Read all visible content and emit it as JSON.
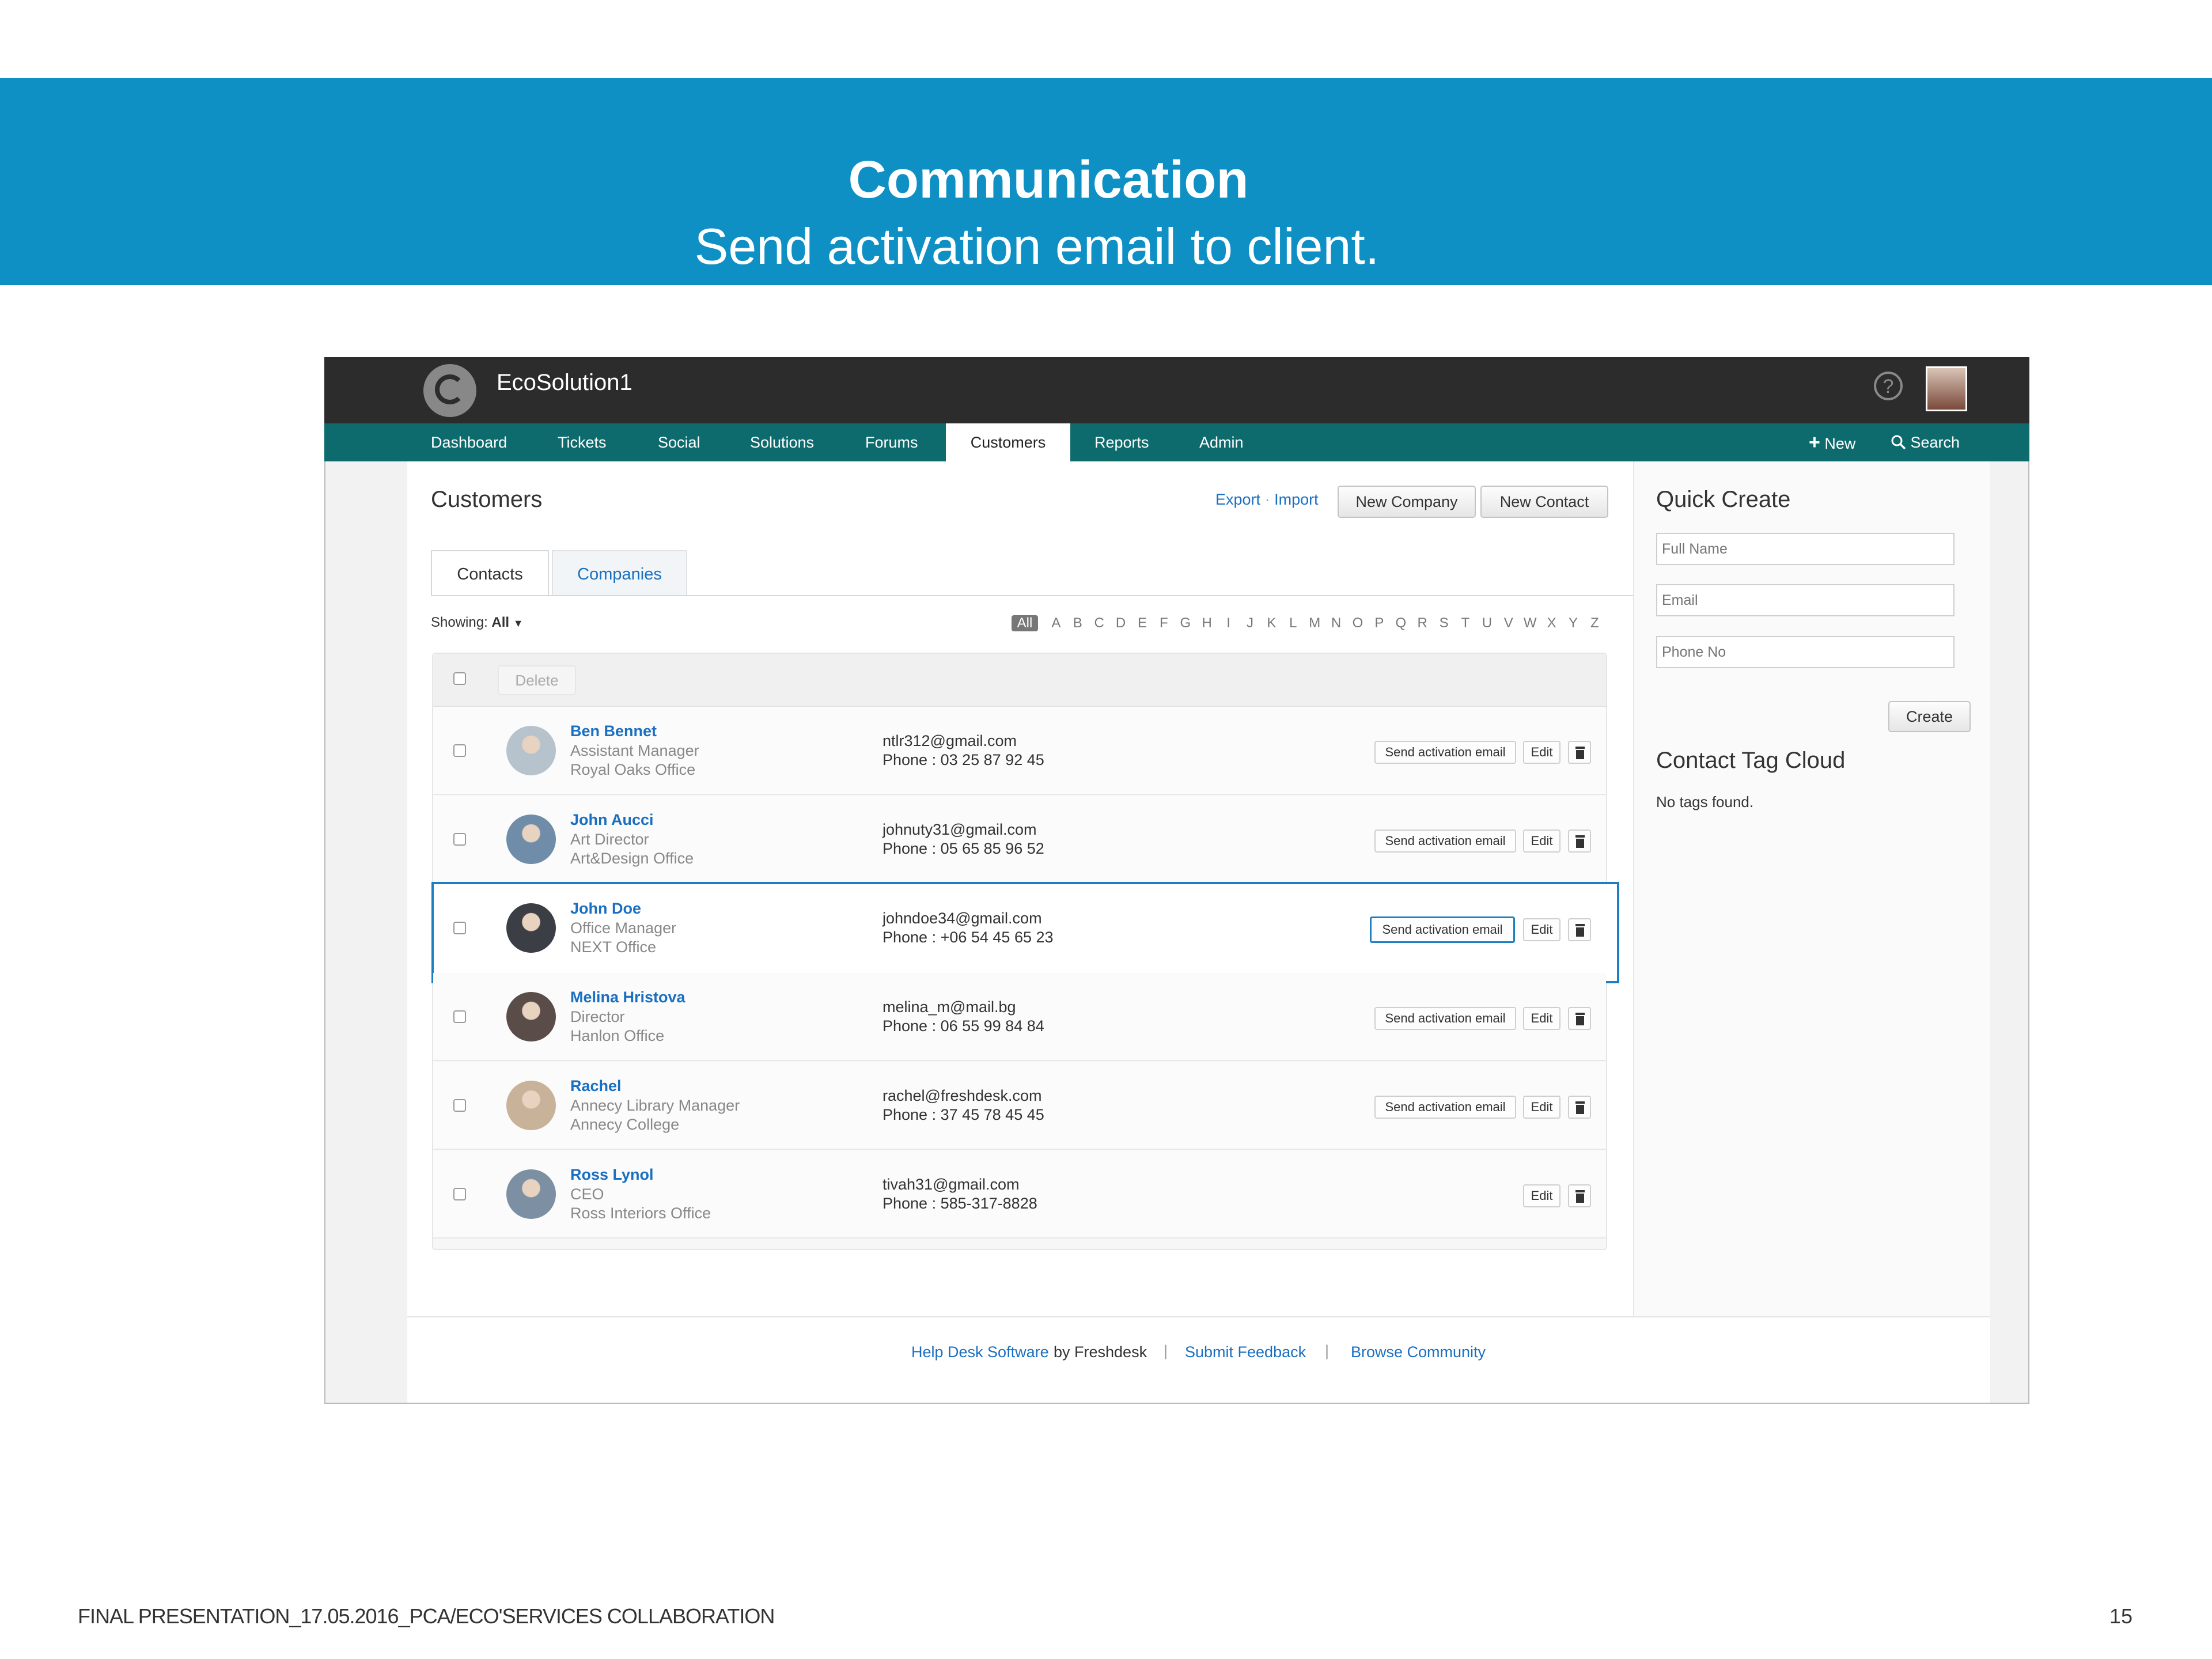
{
  "slide": {
    "title": "Communication",
    "subtitle": "Send activation email to client.",
    "footer": "FINAL PRESENTATION_17.05.2016_PCA/ECO'SERVICES COLLABORATION",
    "page_number": "15"
  },
  "app": {
    "title": "EcoSolution1",
    "nav": [
      "Dashboard",
      "Tickets",
      "Social",
      "Solutions",
      "Forums",
      "Customers",
      "Reports",
      "Admin"
    ],
    "nav_active": "Customers",
    "new_label": "New",
    "search_label": "Search"
  },
  "customers": {
    "title": "Customers",
    "export_label": "Export",
    "import_label": "Import",
    "link_sep": "·",
    "new_company": "New Company",
    "new_contact": "New Contact",
    "tabs": [
      "Contacts",
      "Companies"
    ],
    "showing_label": "Showing:",
    "showing_value": "All",
    "alphabet": [
      "All",
      "A",
      "B",
      "C",
      "D",
      "E",
      "F",
      "G",
      "H",
      "I",
      "J",
      "K",
      "L",
      "M",
      "N",
      "O",
      "P",
      "Q",
      "R",
      "S",
      "T",
      "U",
      "V",
      "W",
      "X",
      "Y",
      "Z"
    ],
    "delete_label": "Delete",
    "send_activation_label": "Send activation email",
    "edit_label": "Edit",
    "contacts": [
      {
        "name": "Ben Bennet",
        "title": "Assistant Manager",
        "company": "Royal Oaks Office",
        "email": "ntlr312@gmail.com",
        "phone": "Phone : 03 25 87 92 45",
        "activation": true
      },
      {
        "name": "John Aucci",
        "title": "Art Director",
        "company": "Art&Design Office",
        "email": "johnuty31@gmail.com",
        "phone": "Phone : 05 65 85 96 52",
        "activation": true
      },
      {
        "name": "John Doe",
        "title": "Office Manager",
        "company": "NEXT Office",
        "email": "johndoe34@gmail.com",
        "phone": "Phone : +06 54 45 65 23",
        "activation": true
      },
      {
        "name": "Melina Hristova",
        "title": "Director",
        "company": "Hanlon Office",
        "email": "melina_m@mail.bg",
        "phone": "Phone : 06 55 99 84 84",
        "activation": true
      },
      {
        "name": "Rachel",
        "title": "Annecy Library Manager",
        "company": "Annecy College",
        "email": "rachel@freshdesk.com",
        "phone": "Phone : 37 45 78 45 45",
        "activation": true
      },
      {
        "name": "Ross Lynol",
        "title": "CEO",
        "company": "Ross Interiors Office",
        "email": "tivah31@gmail.com",
        "phone": "Phone : 585-317-8828",
        "activation": false
      }
    ]
  },
  "quick_create": {
    "title": "Quick Create",
    "full_name_placeholder": "Full Name",
    "email_placeholder": "Email",
    "phone_placeholder": "Phone No",
    "create_label": "Create"
  },
  "tag_cloud": {
    "title": "Contact Tag Cloud",
    "empty_text": "No tags found."
  },
  "footer": {
    "help_desk_link": "Help Desk Software",
    "by_text": "by Freshdesk",
    "sep": "|",
    "submit_feedback": "Submit Feedback",
    "browse_community": "Browse Community"
  },
  "colors": {
    "banner": "#0e90c4",
    "topbar": "#2c2c2c",
    "navbar": "#0d6b6e",
    "link": "#1a6fc0",
    "highlight": "#1d7ec4"
  }
}
